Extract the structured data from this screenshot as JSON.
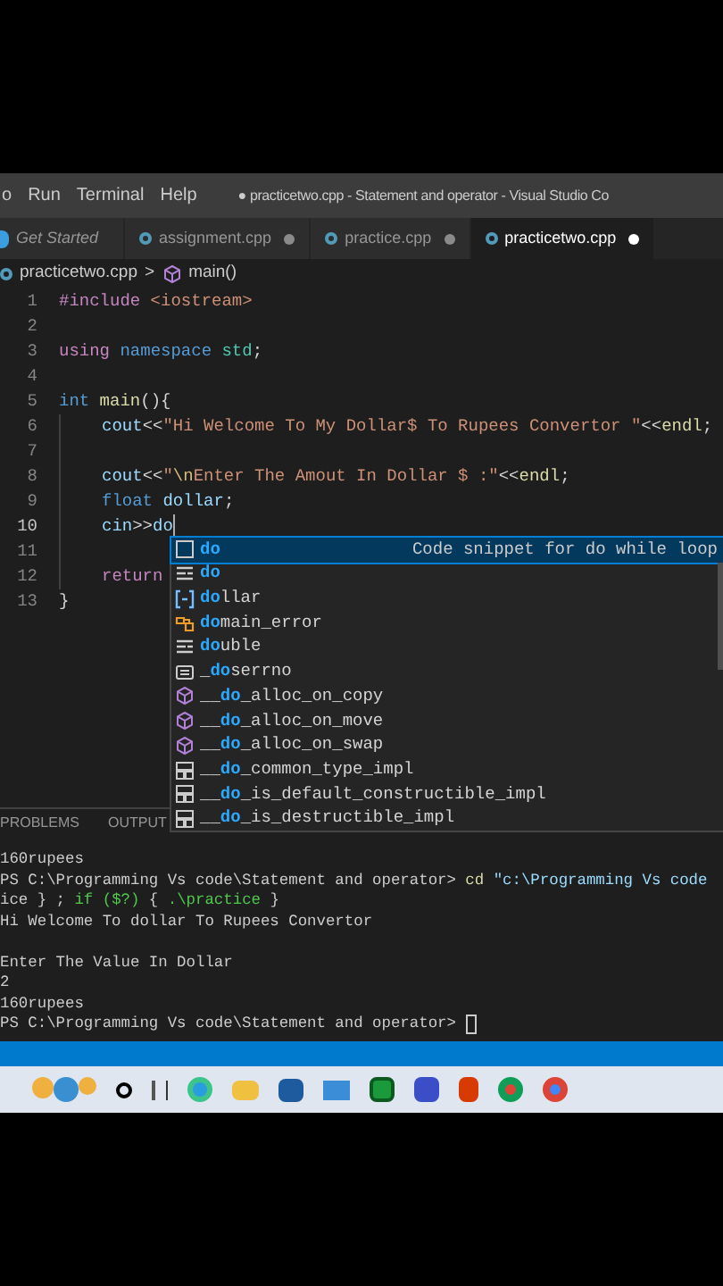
{
  "menu": {
    "items": [
      "o",
      "Run",
      "Terminal",
      "Help"
    ],
    "title": "● practicetwo.cpp - Statement and operator - Visual Studio Co"
  },
  "tabs": [
    {
      "label": "Get Started",
      "kind": "welcome",
      "dirty": false,
      "selected": false
    },
    {
      "label": "assignment.cpp",
      "kind": "cpp",
      "dirty": true,
      "selected": false
    },
    {
      "label": "practice.cpp",
      "kind": "cpp",
      "dirty": true,
      "selected": false
    },
    {
      "label": "practicetwo.cpp",
      "kind": "cpp",
      "dirty": true,
      "selected": true
    }
  ],
  "breadcrumb": {
    "file": "practicetwo.cpp",
    "separator": ">",
    "symbol": "main()"
  },
  "editor": {
    "lines": [
      {
        "number": "1",
        "indented": false,
        "current": false,
        "tokens": [
          {
            "kind": "keyword",
            "text": "#include"
          },
          {
            "kind": "string",
            "text": " <iostream>"
          }
        ]
      },
      {
        "number": "2",
        "current": false
      },
      {
        "number": "3",
        "indented": false,
        "current": false,
        "tokens": [
          {
            "kind": "keyword",
            "text": "using"
          },
          {
            "kind": "type",
            "text": " namespace"
          },
          {
            "kind": "ns",
            "text": " std"
          },
          {
            "kind": "plain",
            "text": ";"
          }
        ]
      },
      {
        "number": "4",
        "current": false
      },
      {
        "number": "5",
        "indented": false,
        "current": false,
        "tokens": [
          {
            "kind": "type",
            "text": "int"
          },
          {
            "kind": "func",
            "text": " main"
          },
          {
            "kind": "plain",
            "text": "(){"
          }
        ]
      },
      {
        "number": "6",
        "indented": true,
        "current": false,
        "tokens": [
          {
            "kind": "var",
            "text": "cout"
          },
          {
            "kind": "plain",
            "text": "<<"
          },
          {
            "kind": "string",
            "text": "\"Hi Welcome To My Dollar$ To Rupees Convertor \""
          },
          {
            "kind": "plain",
            "text": "<<"
          },
          {
            "kind": "func",
            "text": "endl"
          },
          {
            "kind": "plain",
            "text": ";"
          }
        ]
      },
      {
        "number": "7",
        "indented": true,
        "current": false
      },
      {
        "number": "8",
        "indented": true,
        "current": false,
        "tokens": [
          {
            "kind": "var",
            "text": "cout"
          },
          {
            "kind": "plain",
            "text": "<<"
          },
          {
            "kind": "string",
            "text": "\""
          },
          {
            "kind": "escape",
            "text": "\\n"
          },
          {
            "kind": "string",
            "text": "Enter The Amout In Dollar $ :\""
          },
          {
            "kind": "plain",
            "text": "<<"
          },
          {
            "kind": "func",
            "text": "endl"
          },
          {
            "kind": "plain",
            "text": ";"
          }
        ]
      },
      {
        "number": "9",
        "indented": true,
        "current": false,
        "tokens": [
          {
            "kind": "type",
            "text": "float"
          },
          {
            "kind": "var",
            "text": " dollar"
          },
          {
            "kind": "plain",
            "text": ";"
          }
        ]
      },
      {
        "number": "10",
        "indented": true,
        "current": true,
        "tokens": [
          {
            "kind": "var",
            "text": "cin"
          },
          {
            "kind": "plain",
            "text": ">>"
          },
          {
            "kind": "var",
            "text": "do"
          }
        ]
      },
      {
        "number": "11",
        "indented": true,
        "current": false
      },
      {
        "number": "12",
        "indented": true,
        "current": false,
        "tokens": [
          {
            "kind": "keyword",
            "text": "return"
          }
        ]
      },
      {
        "number": "13",
        "indented": false,
        "current": false,
        "tokens": [
          {
            "kind": "plain",
            "text": "}"
          }
        ]
      }
    ]
  },
  "suggestions": {
    "items": [
      {
        "kind": "snippet",
        "match": "do",
        "selected": true,
        "detail": "Code snippet for do while loop"
      },
      {
        "kind": "keyword",
        "match": "do",
        "selected": false
      },
      {
        "kind": "variable",
        "match": "do",
        "after": "llar",
        "selected": false
      },
      {
        "kind": "class",
        "match": "do",
        "after": "main_error",
        "selected": false
      },
      {
        "kind": "keyword",
        "match": "do",
        "after": "uble",
        "selected": false
      },
      {
        "kind": "field",
        "before": "_",
        "match": "do",
        "after": "serrno",
        "selected": false
      },
      {
        "kind": "method",
        "before": "__",
        "match": "do",
        "after": "_alloc_on_copy",
        "selected": false
      },
      {
        "kind": "method",
        "before": "__",
        "match": "do",
        "after": "_alloc_on_move",
        "selected": false
      },
      {
        "kind": "method",
        "before": "__",
        "match": "do",
        "after": "_alloc_on_swap",
        "selected": false
      },
      {
        "kind": "struct",
        "before": "__",
        "match": "do",
        "after": "_common_type_impl",
        "selected": false
      },
      {
        "kind": "struct",
        "before": "__",
        "match": "do",
        "after": "_is_default_constructible_impl",
        "selected": false
      },
      {
        "kind": "struct",
        "before": "__",
        "match": "do",
        "after": "_is_destructible_impl",
        "selected": false
      }
    ]
  },
  "panel": {
    "tabs": [
      "PROBLEMS",
      "OUTPUT"
    ],
    "terminal": [
      [
        {
          "kind": "plain",
          "text": "160rupees"
        }
      ],
      [
        {
          "kind": "plain",
          "text": "PS C:\\Programming Vs code\\Statement and operator> "
        },
        {
          "kind": "command",
          "text": "cd"
        },
        {
          "kind": "string",
          "text": " \"c:\\Programming Vs code"
        }
      ],
      [
        {
          "kind": "plain",
          "text": "ice } ; "
        },
        {
          "kind": "keyword",
          "text": "if ($?)"
        },
        {
          "kind": "plain",
          "text": " { "
        },
        {
          "kind": "keyword",
          "text": ".\\practice"
        },
        {
          "kind": "plain",
          "text": " }"
        }
      ],
      [
        {
          "kind": "plain",
          "text": "Hi Welcome To dollar To Rupees Convertor"
        }
      ],
      [
        {
          "kind": "blank"
        }
      ],
      [
        {
          "kind": "plain",
          "text": "Enter The Value In Dollar"
        }
      ],
      [
        {
          "kind": "plain",
          "text": "2"
        }
      ],
      [
        {
          "kind": "plain",
          "text": "160rupees"
        }
      ],
      [
        {
          "kind": "plain",
          "text": "PS C:\\Programming Vs code\\Statement and operator> "
        }
      ]
    ]
  }
}
